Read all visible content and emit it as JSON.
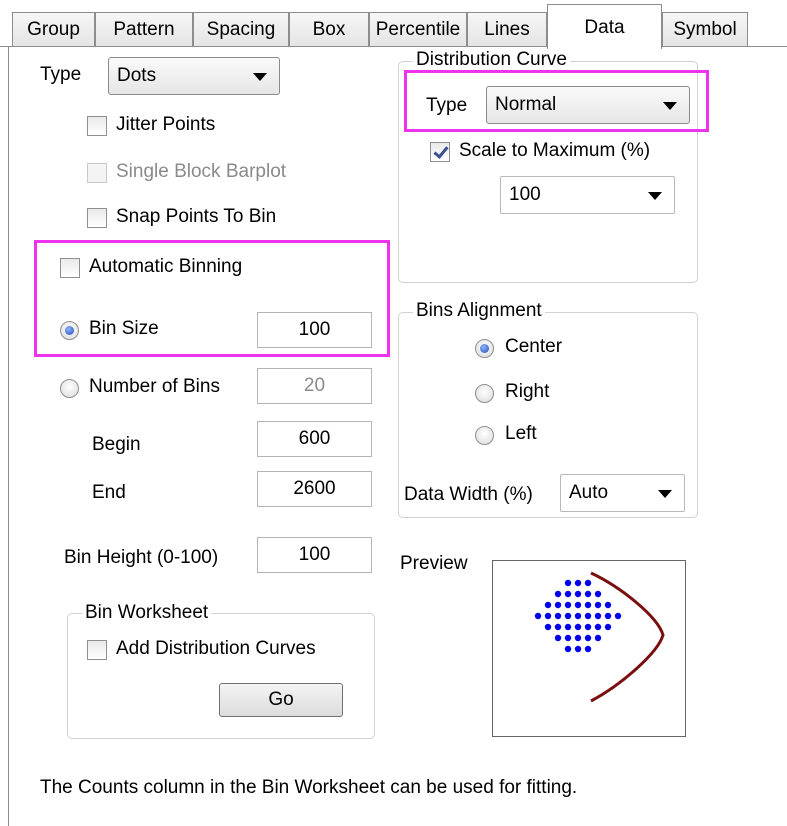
{
  "tabs": [
    {
      "label": "Group",
      "active": false
    },
    {
      "label": "Pattern",
      "active": false
    },
    {
      "label": "Spacing",
      "active": false
    },
    {
      "label": "Box",
      "active": false
    },
    {
      "label": "Percentile",
      "active": false
    },
    {
      "label": "Lines",
      "active": false
    },
    {
      "label": "Data",
      "active": true
    },
    {
      "label": "Symbol",
      "active": false
    }
  ],
  "type_section": {
    "label": "Type",
    "value": "Dots",
    "jitter_points": {
      "label": "Jitter Points",
      "checked": false
    },
    "single_block_barplot": {
      "label": "Single Block Barplot",
      "checked": false,
      "disabled": true
    },
    "snap_points_to_bin": {
      "label": "Snap Points To Bin",
      "checked": false
    }
  },
  "binning": {
    "automatic_binning": {
      "label": "Automatic Binning",
      "checked": false
    },
    "bin_size": {
      "label": "Bin Size",
      "value": "100",
      "selected": true
    },
    "number_of_bins": {
      "label": "Number of Bins",
      "value": "20",
      "selected": false
    },
    "begin": {
      "label": "Begin",
      "value": "600"
    },
    "end": {
      "label": "End",
      "value": "2600"
    },
    "bin_height": {
      "label": "Bin Height (0-100)",
      "value": "100"
    }
  },
  "bin_worksheet": {
    "title": "Bin Worksheet",
    "add_distribution_curves": {
      "label": "Add Distribution Curves",
      "checked": false
    },
    "go_button": "Go"
  },
  "distribution_curve": {
    "title": "Distribution Curve",
    "type_label": "Type",
    "type_value": "Normal",
    "scale_to_maximum": {
      "label": "Scale to Maximum (%)",
      "checked": true
    },
    "scale_value": "100"
  },
  "bins_alignment": {
    "title": "Bins Alignment",
    "options": [
      {
        "label": "Center",
        "selected": true
      },
      {
        "label": "Right",
        "selected": false
      },
      {
        "label": "Left",
        "selected": false
      }
    ],
    "data_width_label": "Data Width (%)",
    "data_width_value": "Auto"
  },
  "preview": {
    "label": "Preview"
  },
  "footer_note": "The Counts column in the Bin Worksheet can be used for fitting.",
  "colors": {
    "highlight": "#ee33ee",
    "dots": "#0000ee",
    "curve": "#7a0f0f"
  }
}
